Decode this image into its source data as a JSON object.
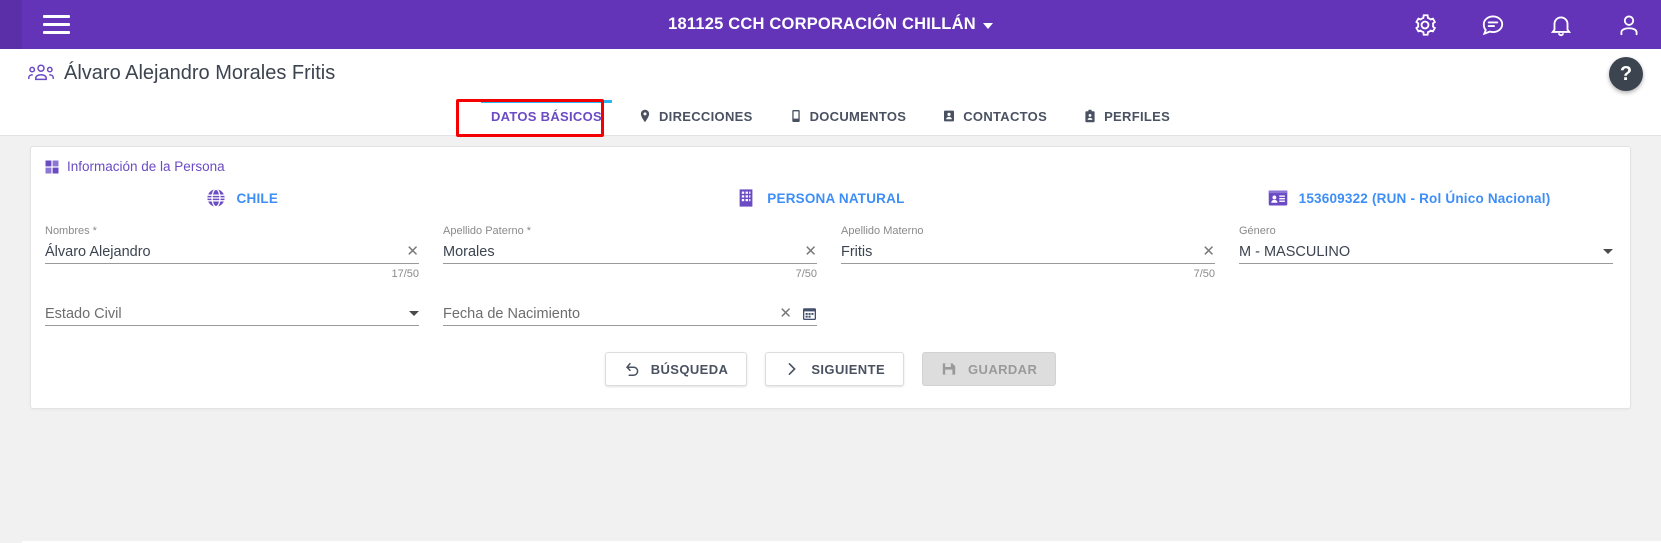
{
  "topbar": {
    "menu_icon": "hamburger-menu-icon",
    "title": "181125 CCH CORPORACIÓN CHILLÁN",
    "actions": [
      {
        "name": "gear-icon",
        "label": "Configuración"
      },
      {
        "name": "chat-icon",
        "label": "Mensajes"
      },
      {
        "name": "bell-icon",
        "label": "Notificaciones"
      },
      {
        "name": "user-icon",
        "label": "Usuario"
      }
    ],
    "background": "#6333b8"
  },
  "page_header": {
    "icon": "people-group-icon",
    "title": "Álvaro Alejandro Morales Fritis",
    "help_label": "?"
  },
  "tabs": [
    {
      "label": "DATOS BÁSICOS",
      "icon": "none",
      "active": true
    },
    {
      "label": "DIRECCIONES",
      "icon": "map-pin-icon",
      "active": false
    },
    {
      "label": "DOCUMENTOS",
      "icon": "document-icon",
      "active": false
    },
    {
      "label": "CONTACTOS",
      "icon": "contact-card-icon",
      "active": false
    },
    {
      "label": "PERFILES",
      "icon": "badge-icon",
      "active": false
    }
  ],
  "card": {
    "header": {
      "icon": "grid-icon",
      "label": "Información de la Persona"
    },
    "chips": [
      {
        "icon": "globe-icon",
        "label": "CHILE"
      },
      {
        "icon": "building-icon",
        "label": "PERSONA NATURAL"
      },
      {
        "icon": "id-card-icon",
        "label": "153609322 (RUN - Rol Único Nacional)"
      }
    ],
    "fields": {
      "nombres": {
        "label": "Nombres *",
        "value": "Álvaro Alejandro",
        "counter": "17/50"
      },
      "apellido_pat": {
        "label": "Apellido Paterno *",
        "value": "Morales",
        "counter": "7/50"
      },
      "apellido_mat": {
        "label": "Apellido Materno",
        "value": "Fritis",
        "counter": "7/50"
      },
      "genero": {
        "label": "Género",
        "value": "M - MASCULINO"
      },
      "estado_civil": {
        "label": "Estado Civil",
        "value": ""
      },
      "fecha_nac": {
        "label": "Fecha de Nacimiento",
        "value": ""
      }
    }
  },
  "buttons": {
    "busqueda": "BÚSQUEDA",
    "siguiente": "SIGUIENTE",
    "guardar": "GUARDAR"
  },
  "colors": {
    "brand_purple": "#6333b8",
    "accent_purple": "#6b4bc4",
    "link_blue": "#3d8ef7",
    "tab_underline": "#29b6f6",
    "highlight_red": "#f50000"
  }
}
